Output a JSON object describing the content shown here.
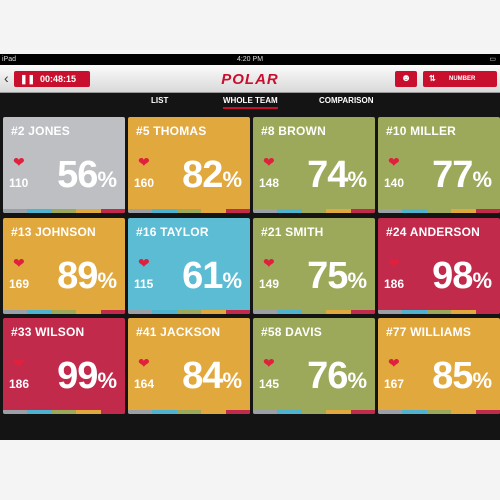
{
  "status_bar": {
    "device": "iPad",
    "time": "4:20 PM"
  },
  "toolbar": {
    "back_icon": "arrow-left-icon",
    "timer_pause_icon": "pause-icon",
    "timer": "00:48:15",
    "logo": "POLAR",
    "user_button_icon": "user-add-icon",
    "sort_label": "NUMBER",
    "accent_color": "#c8102e"
  },
  "tabs": [
    {
      "label": "LIST",
      "active": false
    },
    {
      "label": "WHOLE TEAM",
      "active": true
    },
    {
      "label": "COMPARISON",
      "active": false
    }
  ],
  "heart_symbol": "❤",
  "percent_sign": "%",
  "tiles": [
    {
      "name": "#2 JONES",
      "hr": "110",
      "pct": "56",
      "color": "#bdbfc3"
    },
    {
      "name": "#5 THOMAS",
      "hr": "160",
      "pct": "82",
      "color": "#e1a83e"
    },
    {
      "name": "#8 BROWN",
      "hr": "148",
      "pct": "74",
      "color": "#9ca85a"
    },
    {
      "name": "#10 MILLER",
      "hr": "140",
      "pct": "77",
      "color": "#9ca85a"
    },
    {
      "name": "#13 JOHNSON",
      "hr": "169",
      "pct": "89",
      "color": "#e1a83e"
    },
    {
      "name": "#16 TAYLOR",
      "hr": "115",
      "pct": "61",
      "color": "#5bbcd3"
    },
    {
      "name": "#21 SMITH",
      "hr": "149",
      "pct": "75",
      "color": "#9ca85a"
    },
    {
      "name": "#24 ANDERSON",
      "hr": "186",
      "pct": "98",
      "color": "#c22a4c"
    },
    {
      "name": "#33 WILSON",
      "hr": "186",
      "pct": "99",
      "color": "#c22a4c"
    },
    {
      "name": "#41 JACKSON",
      "hr": "164",
      "pct": "84",
      "color": "#e1a83e"
    },
    {
      "name": "#58 DAVIS",
      "hr": "145",
      "pct": "76",
      "color": "#9ca85a"
    },
    {
      "name": "#77 WILLIAMS",
      "hr": "167",
      "pct": "85",
      "color": "#e1a83e"
    }
  ],
  "zone_colors": [
    "#9aa0a6",
    "#4fb3cf",
    "#9ca85a",
    "#e1a83e",
    "#c22a4c"
  ]
}
